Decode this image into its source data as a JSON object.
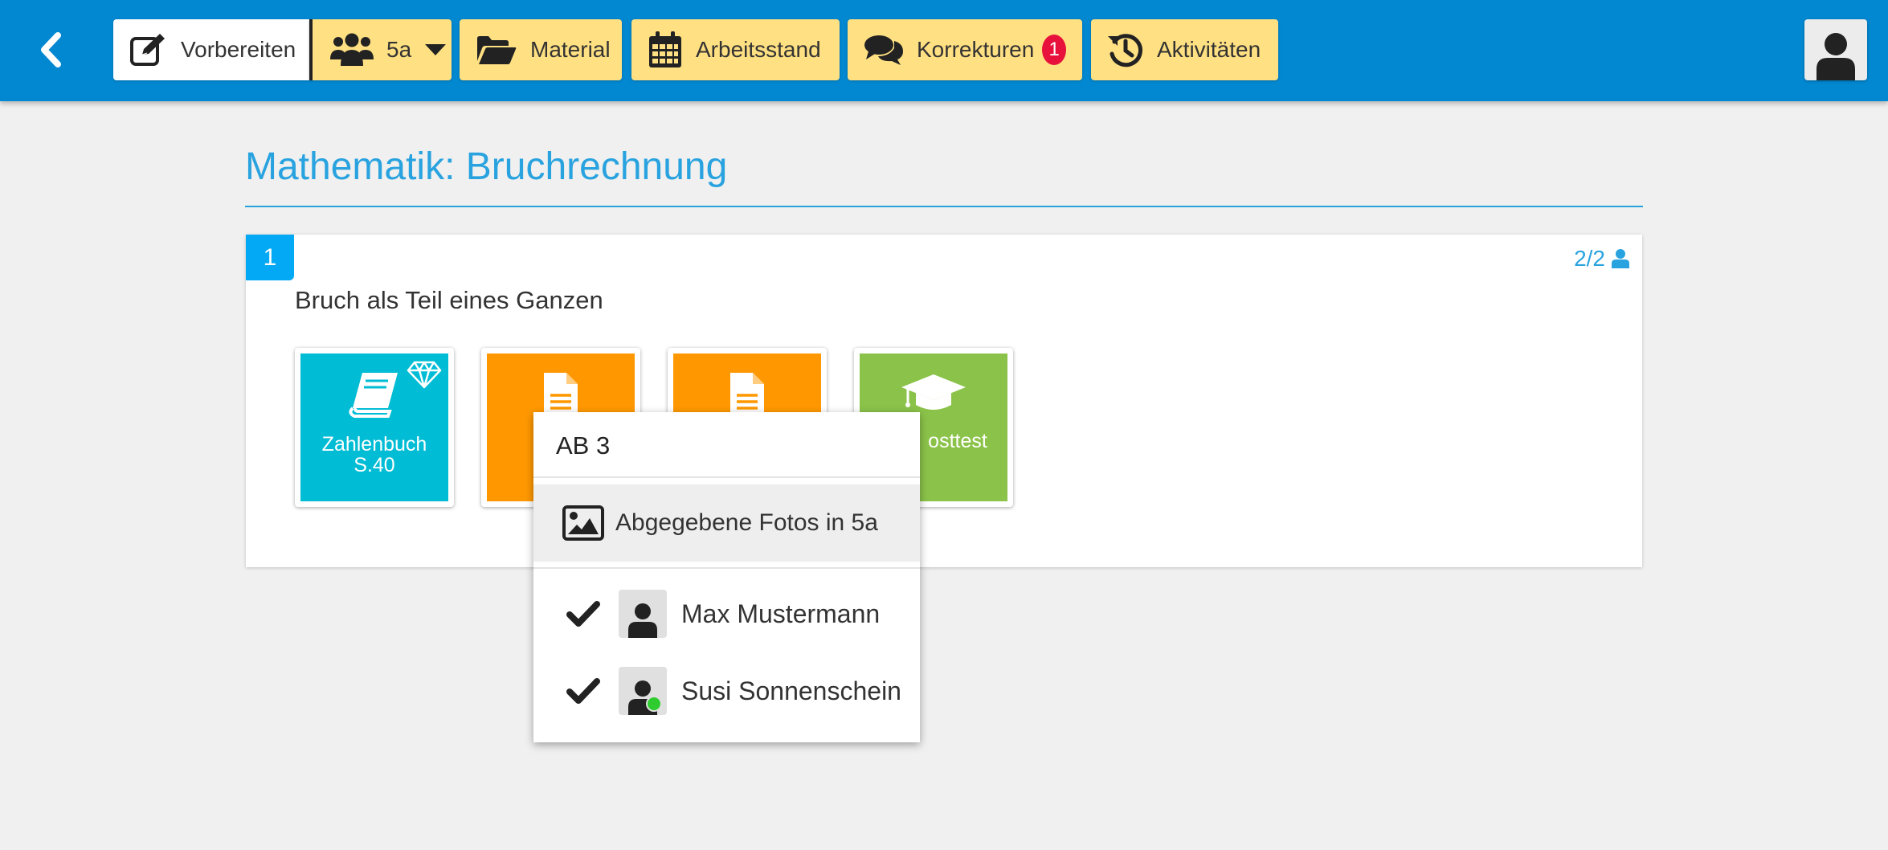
{
  "topbar": {
    "background": "#0288d1",
    "back_icon": "chevron-left-icon",
    "nav": [
      {
        "label": "Vorbereiten",
        "icon": "edit-icon",
        "active": true
      },
      {
        "label": "5a",
        "icon": "users-icon",
        "dropdown": true
      },
      {
        "label": "Material",
        "icon": "folder-open-icon"
      },
      {
        "label": "Arbeitsstand",
        "icon": "calendar-icon"
      },
      {
        "label": "Korrekturen",
        "icon": "comments-icon",
        "badge": "1"
      },
      {
        "label": "Aktivitäten",
        "icon": "history-icon"
      }
    ],
    "accent": "#ffe082",
    "badge_color": "#e8113b",
    "user_icon": "user-icon"
  },
  "page": {
    "title": "Mathematik: Bruchrechnung",
    "title_color": "#29a3df"
  },
  "unit": {
    "number": "1",
    "subtitle": "Bruch als Teil eines Ganzen",
    "progress": "2/2",
    "progress_icon": "user-icon",
    "tiles": [
      {
        "label": "Zahlenbuch S.40",
        "icon": "book-icon",
        "extra_icon": "diamond-icon",
        "color": "#00bcd4"
      },
      {
        "label": "",
        "icon": "file-icon",
        "color": "#ff9800"
      },
      {
        "label": "",
        "icon": "file-icon",
        "color": "#ff9800"
      },
      {
        "label": "osttest",
        "icon": "graduation-cap-icon",
        "color": "#8bc34a"
      }
    ]
  },
  "popup": {
    "title": "AB 3",
    "photos_label": "Abgegebene Fotos in 5a",
    "photos_icon": "image-icon",
    "students": [
      {
        "name": "Max Mustermann",
        "checked": true,
        "online": false
      },
      {
        "name": "Susi Sonnenschein",
        "checked": true,
        "online": true
      }
    ]
  }
}
